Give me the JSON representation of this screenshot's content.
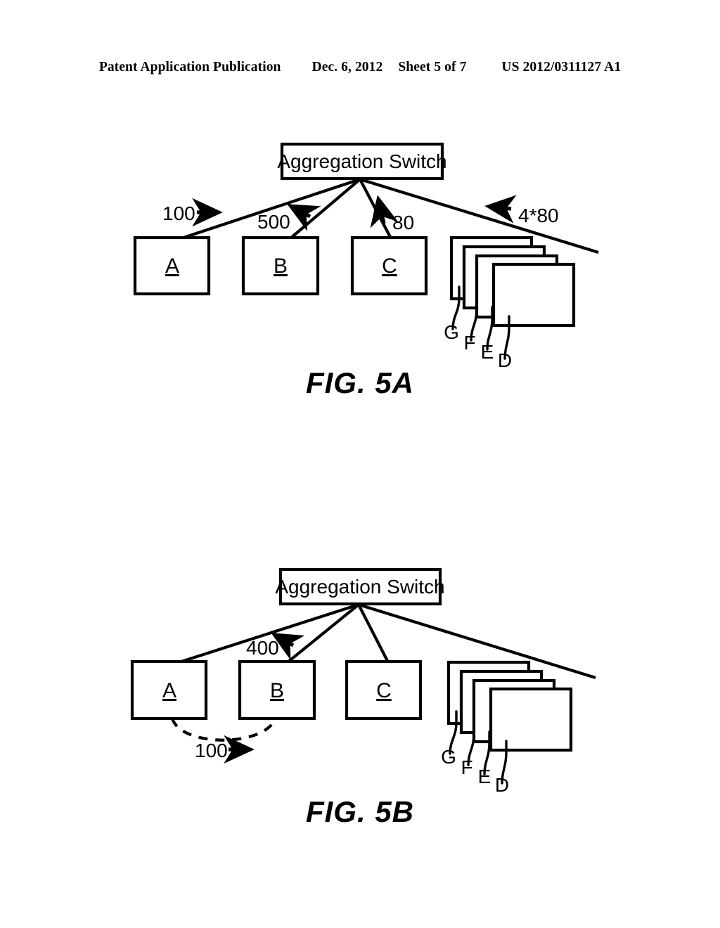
{
  "header": {
    "publication": "Patent Application Publication",
    "date": "Dec. 6, 2012",
    "sheet": "Sheet 5 of 7",
    "patent_number": "US 2012/0311127 A1"
  },
  "figures": [
    {
      "id": "fig5a",
      "caption": "FIG. 5A",
      "switch_label": "Aggregation Switch",
      "nodes": [
        {
          "label": "A",
          "underlined": true
        },
        {
          "label": "B",
          "underlined": true
        },
        {
          "label": "C",
          "underlined": true
        }
      ],
      "stack_labels": [
        "G",
        "F",
        "E",
        "D"
      ],
      "flow_labels": [
        {
          "value": "100",
          "arrow": "right"
        },
        {
          "value": "500",
          "arrow": "up-left"
        },
        {
          "value": "80",
          "arrow": "up"
        },
        {
          "value": "4*80",
          "arrow": "left"
        }
      ]
    },
    {
      "id": "fig5b",
      "caption": "FIG. 5B",
      "switch_label": "Aggregation Switch",
      "nodes": [
        {
          "label": "A",
          "underlined": true
        },
        {
          "label": "B",
          "underlined": true
        },
        {
          "label": "C",
          "underlined": true
        }
      ],
      "stack_labels": [
        "G",
        "F",
        "E",
        "D"
      ],
      "flow_labels": [
        {
          "value": "400",
          "arrow": "up-left"
        },
        {
          "value": "100",
          "arrow": "right"
        }
      ]
    }
  ],
  "style": {
    "ink": "#000000",
    "paper": "#ffffff"
  }
}
